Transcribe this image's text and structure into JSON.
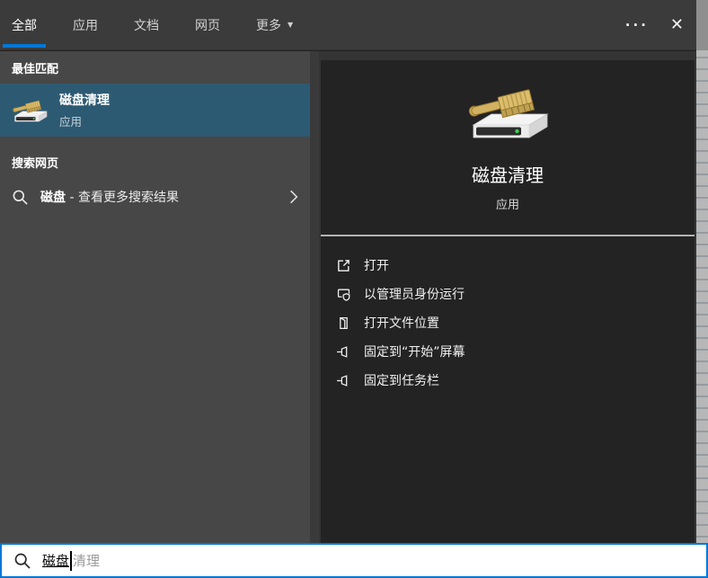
{
  "colors": {
    "accent": "#0078d7",
    "selection": "#2d5a73"
  },
  "topbar": {
    "tabs": [
      {
        "label": "全部"
      },
      {
        "label": "应用"
      },
      {
        "label": "文档"
      },
      {
        "label": "网页"
      },
      {
        "label": "更多"
      }
    ],
    "more_arrow": "▼",
    "overflow": "···",
    "close": "✕"
  },
  "left_panel": {
    "best_match_header": "最佳匹配",
    "best_match": {
      "title": "磁盘清理",
      "subtitle": "应用"
    },
    "web_header": "搜索网页",
    "web_item": {
      "query": "磁盘",
      "rest": " - 查看更多搜索结果"
    }
  },
  "preview_panel": {
    "app_title": "磁盘清理",
    "app_subtitle": "应用",
    "actions": [
      {
        "icon": "open-icon",
        "label": "打开"
      },
      {
        "icon": "run-as-admin-icon",
        "label": "以管理员身份运行"
      },
      {
        "icon": "file-location-icon",
        "label": "打开文件位置"
      },
      {
        "icon": "pin-icon",
        "label": "固定到“开始”屏幕"
      },
      {
        "icon": "pin-icon",
        "label": "固定到任务栏"
      }
    ]
  },
  "search_bar": {
    "value": "磁盘",
    "suggestion": "清理"
  }
}
